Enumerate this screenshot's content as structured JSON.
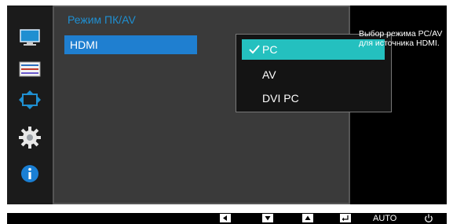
{
  "sidebar": {
    "icons": [
      "picture-icon",
      "onscreen-display-icon",
      "position-size-icon",
      "settings-gear-icon",
      "information-icon"
    ]
  },
  "menu": {
    "section_title": "Режим ПК/AV",
    "item_label": "HDMI"
  },
  "submenu": {
    "options": [
      {
        "label": "PC",
        "selected": true
      },
      {
        "label": "AV",
        "selected": false
      },
      {
        "label": "DVI PC",
        "selected": false
      }
    ]
  },
  "help": {
    "text": "Выбор режима PC/AV для источника HDMI."
  },
  "bottom_bar": {
    "buttons": [
      "left-arrow-icon",
      "down-arrow-icon",
      "up-arrow-icon",
      "enter-icon"
    ],
    "auto_label": "AUTO",
    "power_icon": "power-icon"
  },
  "colors": {
    "accent_blue": "#1f7fd0",
    "title_blue": "#1f8fd1",
    "selected_teal": "#24c0bf"
  }
}
